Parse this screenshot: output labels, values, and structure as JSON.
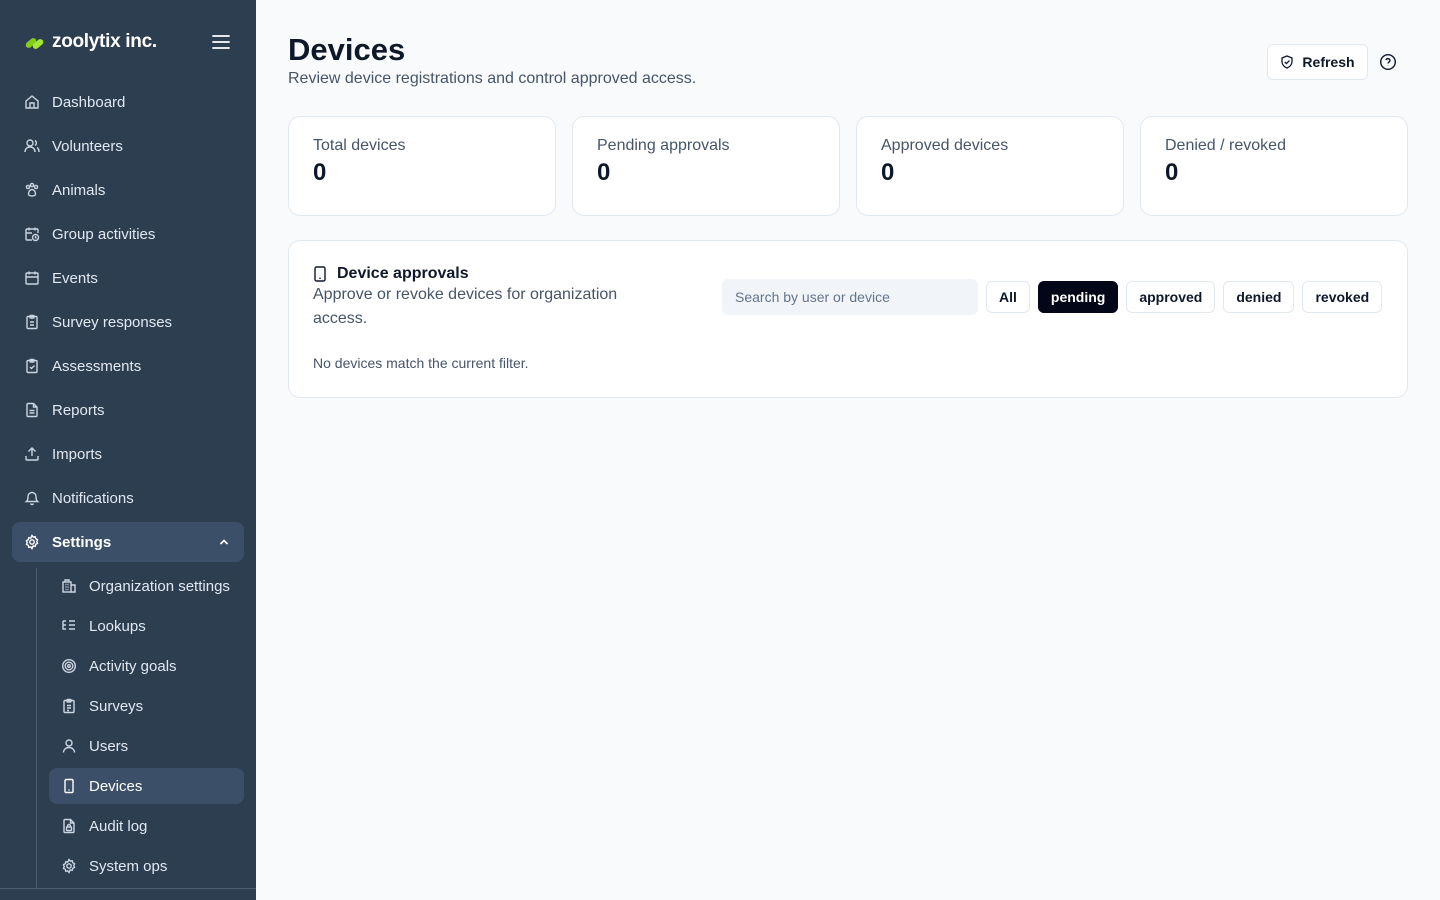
{
  "brand": {
    "name": "zoolytix inc.",
    "accent": "#84cc16"
  },
  "nav": {
    "items": [
      {
        "label": "Dashboard",
        "icon": "home-icon"
      },
      {
        "label": "Volunteers",
        "icon": "users-icon"
      },
      {
        "label": "Animals",
        "icon": "paw-icon"
      },
      {
        "label": "Group activities",
        "icon": "calendar-clock-icon"
      },
      {
        "label": "Events",
        "icon": "calendar-icon"
      },
      {
        "label": "Survey responses",
        "icon": "clipboard-icon"
      },
      {
        "label": "Assessments",
        "icon": "clipboard-check-icon"
      },
      {
        "label": "Reports",
        "icon": "file-text-icon"
      },
      {
        "label": "Imports",
        "icon": "upload-icon"
      },
      {
        "label": "Notifications",
        "icon": "bell-icon"
      }
    ],
    "settings": {
      "label": "Settings",
      "icon": "gear-icon",
      "expanded": true
    },
    "sub_items": [
      {
        "label": "Organization settings",
        "icon": "building-icon"
      },
      {
        "label": "Lookups",
        "icon": "list-tree-icon"
      },
      {
        "label": "Activity goals",
        "icon": "target-icon"
      },
      {
        "label": "Surveys",
        "icon": "clipboard-list-icon"
      },
      {
        "label": "Users",
        "icon": "user-icon"
      },
      {
        "label": "Devices",
        "icon": "smartphone-icon",
        "active": true
      },
      {
        "label": "Audit log",
        "icon": "file-lock-icon"
      },
      {
        "label": "System ops",
        "icon": "cog-icon"
      }
    ]
  },
  "header": {
    "title": "Devices",
    "subtitle": "Review device registrations and control approved access.",
    "refresh_label": "Refresh"
  },
  "stats": [
    {
      "label": "Total devices",
      "value": "0"
    },
    {
      "label": "Pending approvals",
      "value": "0"
    },
    {
      "label": "Approved devices",
      "value": "0"
    },
    {
      "label": "Denied / revoked",
      "value": "0"
    }
  ],
  "approvals": {
    "title": "Device approvals",
    "description": "Approve or revoke devices for organization access.",
    "search_placeholder": "Search by user or device",
    "filters": [
      {
        "label": "All",
        "active": false
      },
      {
        "label": "pending",
        "active": true
      },
      {
        "label": "approved",
        "active": false
      },
      {
        "label": "denied",
        "active": false
      },
      {
        "label": "revoked",
        "active": false
      }
    ],
    "empty_message": "No devices match the current filter."
  }
}
